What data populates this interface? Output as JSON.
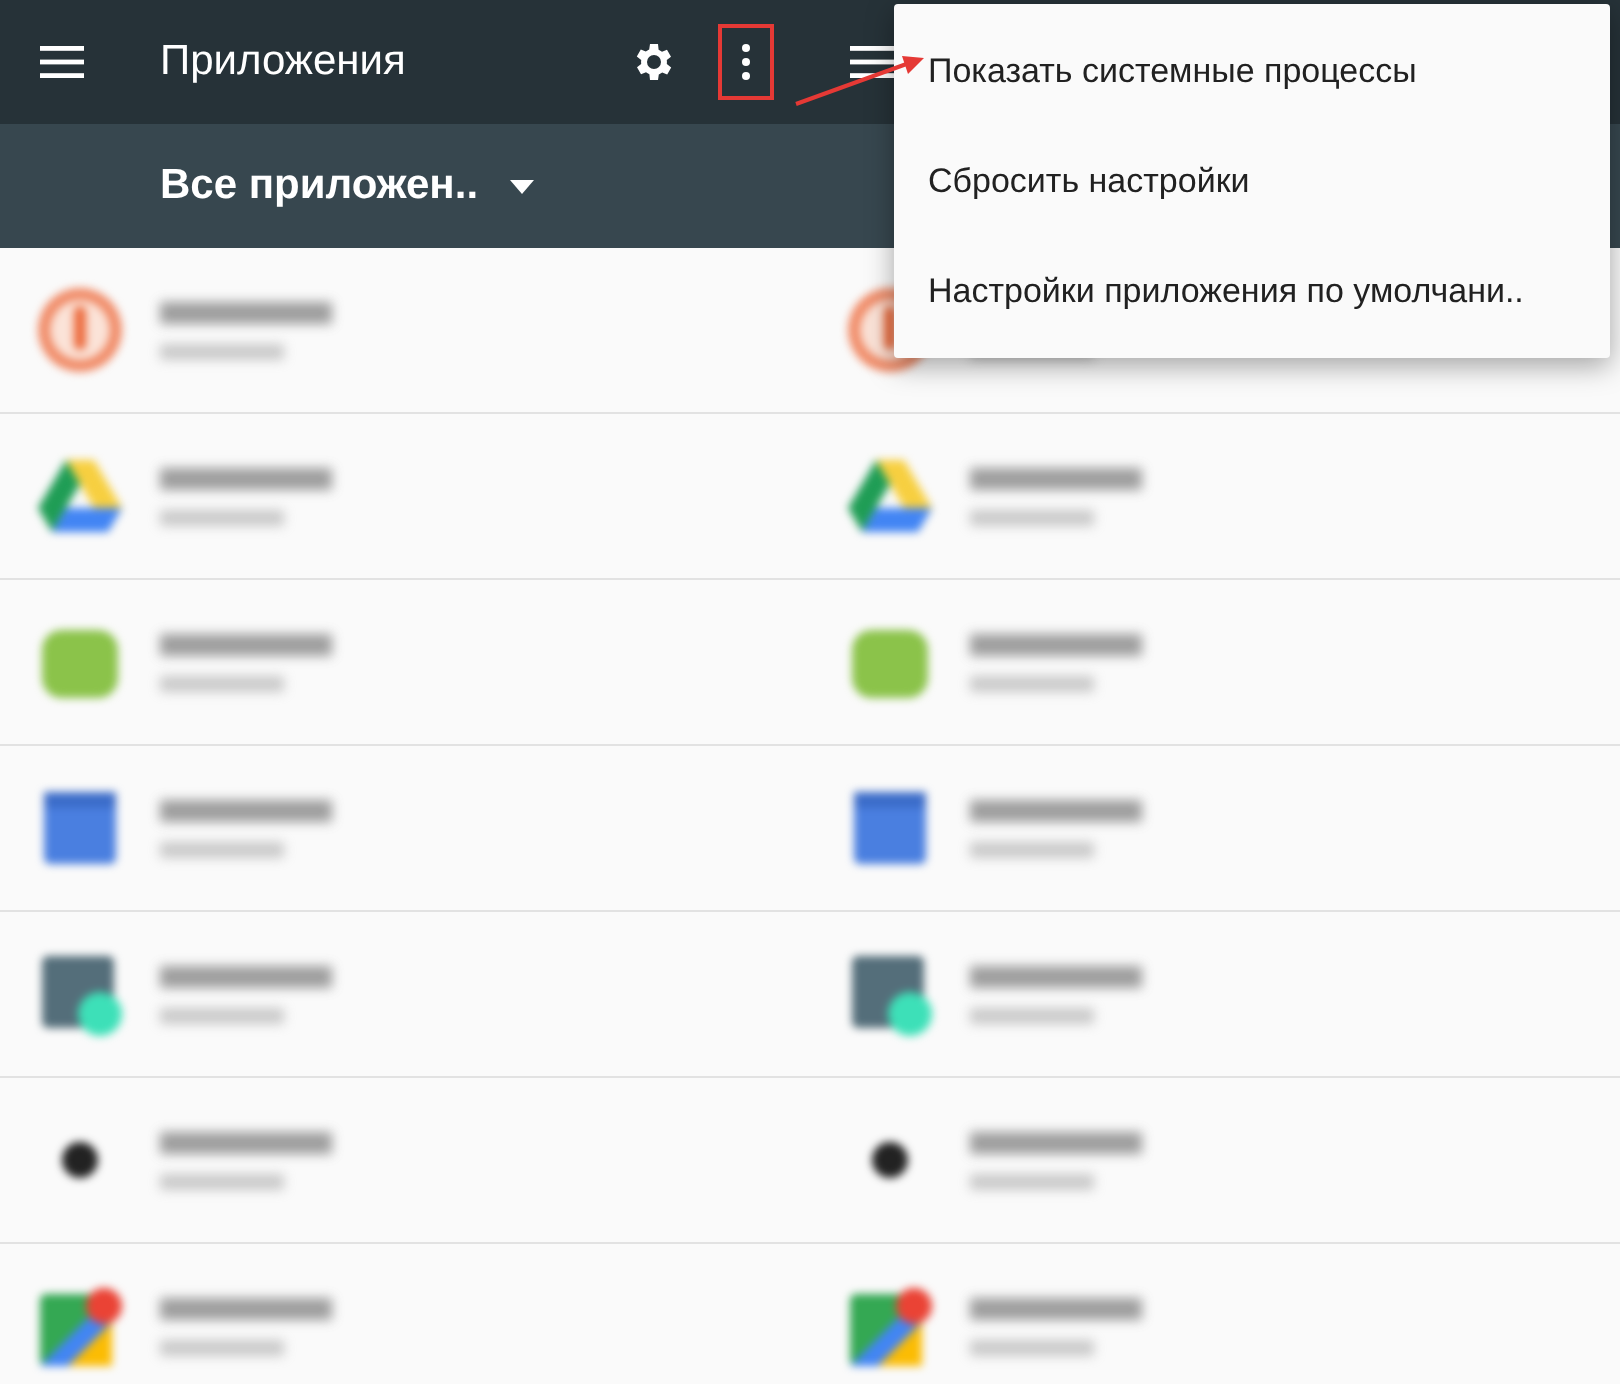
{
  "panels": [
    {
      "header": {
        "title": "Приложения",
        "more_highlighted": true
      },
      "filter": {
        "label": "Все приложен.."
      },
      "apps": [
        {
          "kind": "recorder"
        },
        {
          "kind": "drive"
        },
        {
          "kind": "docs"
        },
        {
          "kind": "calendar"
        },
        {
          "kind": "calculator"
        },
        {
          "kind": "camera"
        },
        {
          "kind": "maps"
        }
      ]
    },
    {
      "apps": [
        {
          "kind": "recorder"
        },
        {
          "kind": "drive"
        },
        {
          "kind": "docs"
        },
        {
          "kind": "calendar"
        },
        {
          "kind": "calculator"
        },
        {
          "kind": "camera"
        },
        {
          "kind": "maps"
        }
      ],
      "menu": [
        {
          "label": "Показать системные процессы"
        },
        {
          "label": "Сбросить настройки"
        },
        {
          "label": "Настройки приложения по умолчани.."
        }
      ]
    }
  ]
}
